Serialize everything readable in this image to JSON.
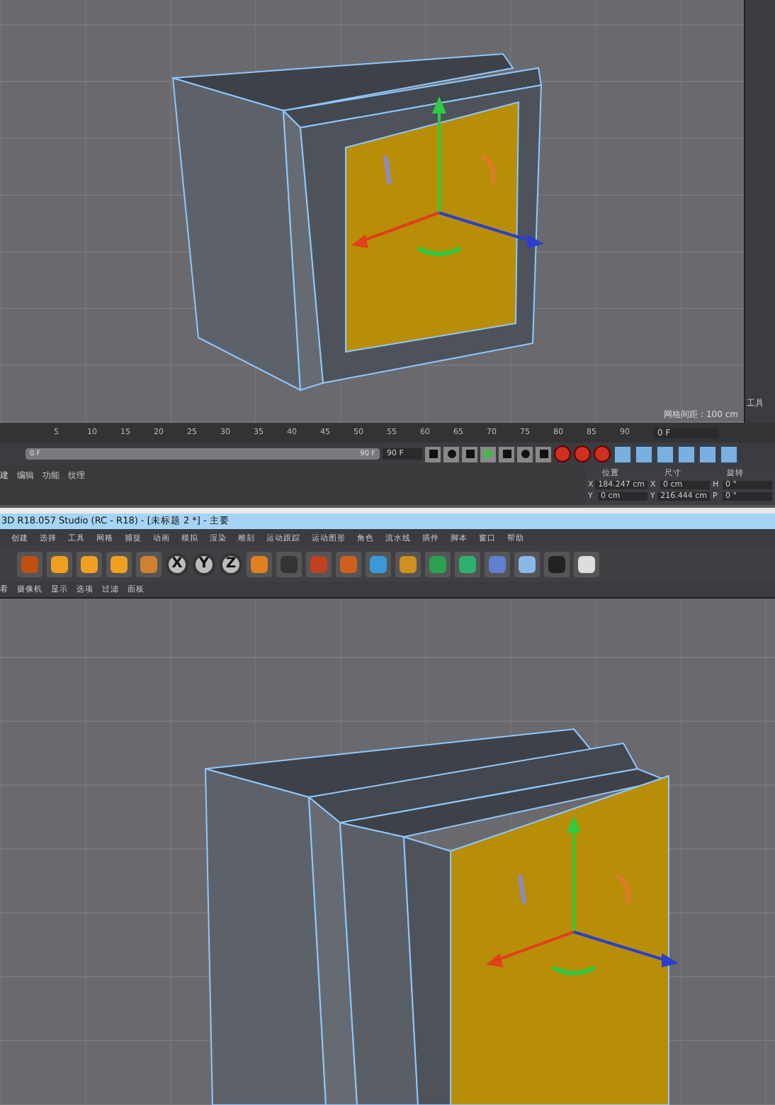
{
  "top_shot": {
    "viewport": {
      "grid_spacing": "网格间距 : 100 cm"
    },
    "side_panel": {
      "items": [
        "工具"
      ]
    },
    "timeline": {
      "ticks": [
        "5",
        "10",
        "15",
        "20",
        "25",
        "30",
        "35",
        "40",
        "45",
        "50",
        "55",
        "60",
        "65",
        "70",
        "75",
        "80",
        "85",
        "90"
      ],
      "current_frame": "0 F"
    },
    "range": {
      "start": "0 F",
      "end": "90 F",
      "level": 1,
      "max_field": "90 F"
    },
    "material_menu": [
      "建",
      "编辑",
      "功能",
      "纹理"
    ],
    "coordinates": {
      "headers": [
        "位置",
        "尺寸",
        "旋转"
      ],
      "rows": [
        {
          "cells": [
            {
              "label": "X",
              "value": "184.247 cm"
            },
            {
              "label": "X",
              "value": "0 cm"
            },
            {
              "label": "H",
              "value": "0 °"
            }
          ]
        },
        {
          "cells": [
            {
              "label": "Y",
              "value": "0 cm"
            },
            {
              "label": "Y",
              "value": "216.444 cm"
            },
            {
              "label": "P",
              "value": "0 °"
            }
          ]
        }
      ]
    }
  },
  "bottom_shot": {
    "window": {
      "title": "3D R18.057 Studio (RC - R18) - [未标题 2 *] - 主要"
    },
    "menu": [
      "创建",
      "选择",
      "工具",
      "网格",
      "捕捉",
      "动画",
      "模拟",
      "渲染",
      "雕刻",
      "运动跟踪",
      "运动图形",
      "角色",
      "流水线",
      "插件",
      "脚本",
      "窗口",
      "帮助"
    ],
    "axis_buttons": [
      {
        "label": "X"
      },
      {
        "label": "Y"
      },
      {
        "label": "Z"
      }
    ],
    "viewport_menu": [
      "看",
      "摄像机",
      "显示",
      "选项",
      "过滤",
      "面板"
    ]
  }
}
